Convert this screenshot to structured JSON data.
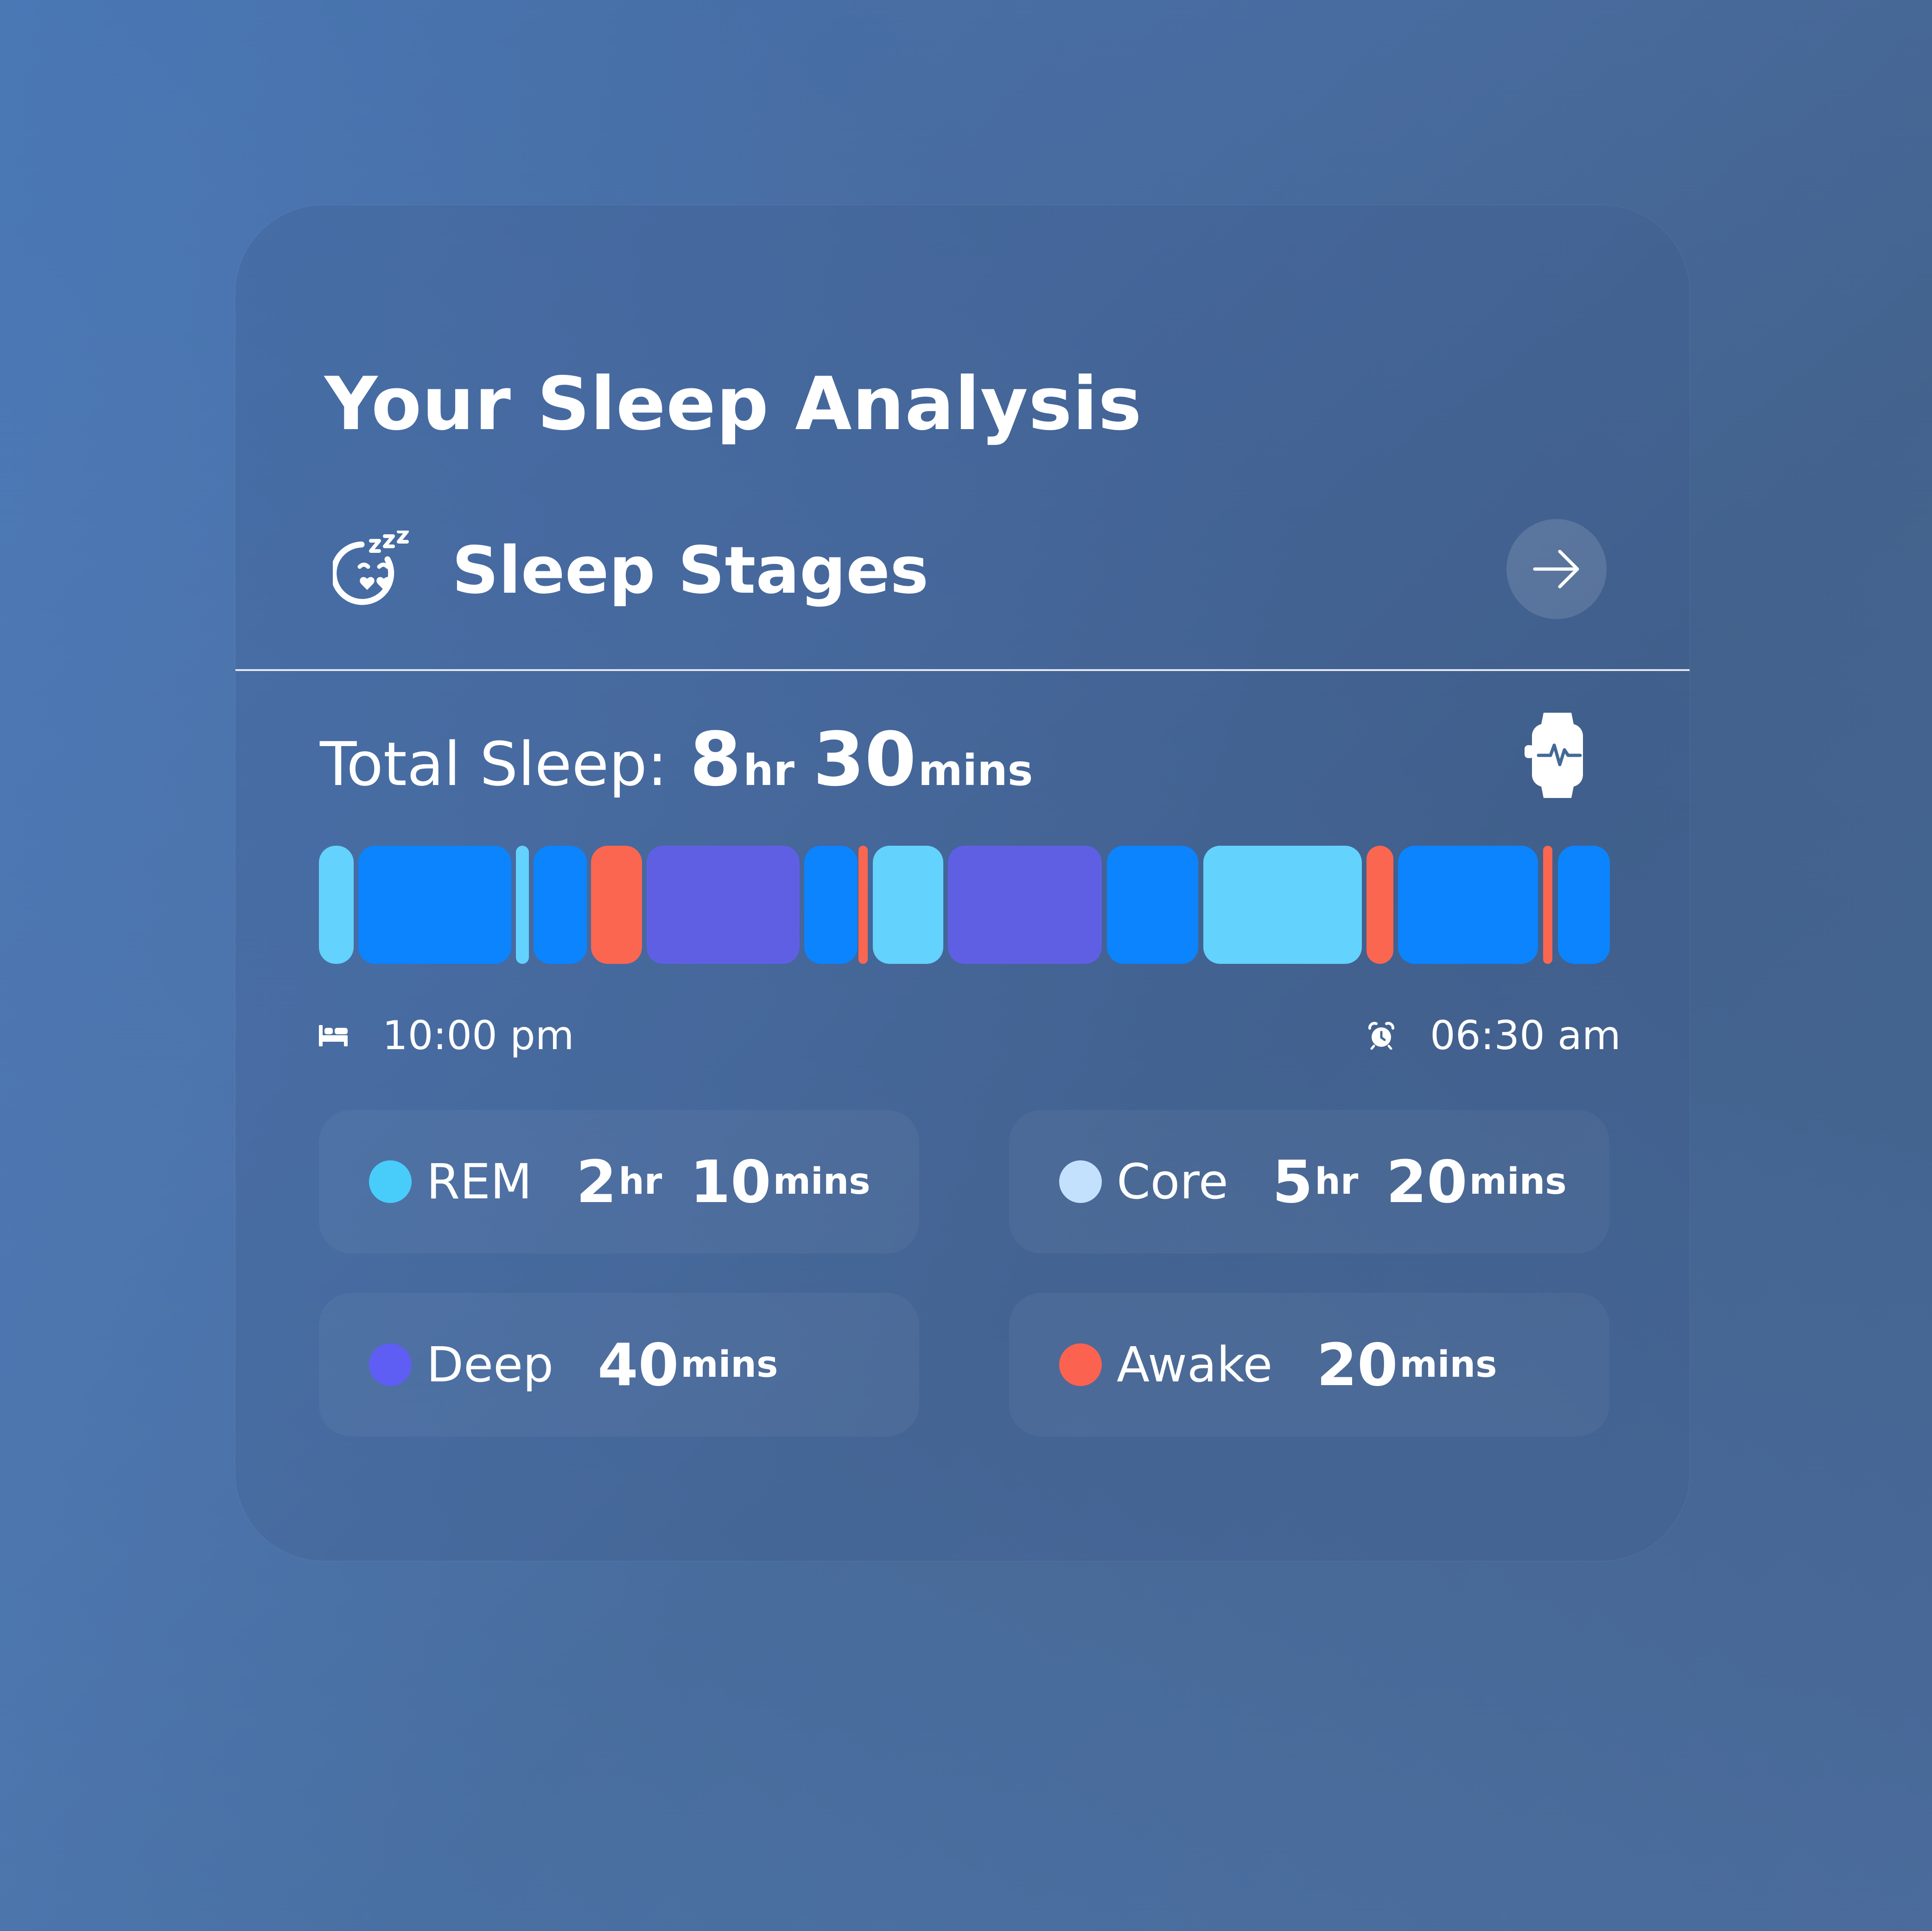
{
  "colors": {
    "rem": "#48cdfb",
    "core": "#c3e1fd",
    "deep": "#5e5ef4",
    "awake": "#fb6250",
    "bar_light": "#63d2fc",
    "bar_blue": "#0b84fd",
    "bar_deep": "#5f5fe3",
    "bar_awake": "#fb6650"
  },
  "header": {
    "title": "Your Sleep Analysis"
  },
  "stages_row": {
    "icon": "sleeping-face-zzz-icon",
    "label": "Sleep Stages",
    "action_icon": "arrow-right-icon"
  },
  "total_sleep": {
    "label": "Total Sleep:",
    "hours": "8",
    "hours_unit": "hr",
    "minutes": "30",
    "minutes_unit": "mins",
    "device_icon": "smartwatch-heartbeat-icon"
  },
  "timeline": {
    "start_icon": "bed-icon",
    "start_time": "10:00 pm",
    "end_icon": "alarm-clock-icon",
    "end_time": "06:30 am",
    "segments": [
      "light",
      "blue",
      "light",
      "blue",
      "awake",
      "deep",
      "blue",
      "awake",
      "light",
      "deep",
      "blue",
      "light",
      "awake",
      "blue",
      "awake",
      "blue"
    ]
  },
  "stats": [
    {
      "key": "rem",
      "name": "REM",
      "hours": "2",
      "hours_unit": "hr",
      "minutes": "10",
      "minutes_unit": "mins"
    },
    {
      "key": "core",
      "name": "Core",
      "hours": "5",
      "hours_unit": "hr",
      "minutes": "20",
      "minutes_unit": "mins"
    },
    {
      "key": "deep",
      "name": "Deep",
      "minutes": "40",
      "minutes_unit": "mins"
    },
    {
      "key": "awake",
      "name": "Awake",
      "minutes": "20",
      "minutes_unit": "mins"
    }
  ]
}
